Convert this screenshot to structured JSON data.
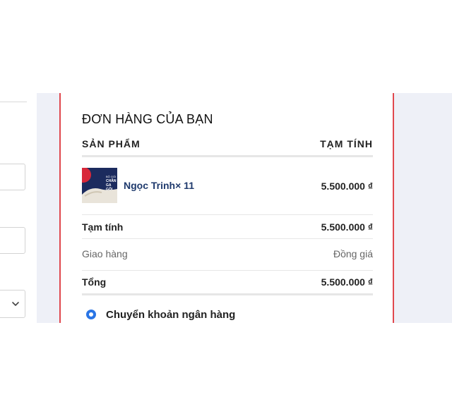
{
  "order": {
    "title": "ĐƠN HÀNG CỦA BẠN",
    "col_product": "SẢN PHẨM",
    "col_subtotal": "TẠM TÍNH"
  },
  "item": {
    "name": "Ngọc Trinh× 11",
    "price": "5.500.000 ₫",
    "thumb_text": [
      "BỘ GỐI",
      "CHĂN",
      "GA",
      "GỐI"
    ]
  },
  "totals": {
    "subtotal_label": "Tạm tính",
    "subtotal_value": "5.500.000 ₫",
    "shipping_label": "Giao hàng",
    "shipping_value": "Đồng giá",
    "total_label": "Tổng",
    "total_value": "5.500.000 ₫"
  },
  "payment": {
    "selected_label": "Chuyển khoản ngân hàng"
  },
  "colors": {
    "accent_red": "#e0484e",
    "radio_blue": "#2a75e5",
    "product_link": "#1f3a6d",
    "backdrop": "#eef0f7"
  }
}
